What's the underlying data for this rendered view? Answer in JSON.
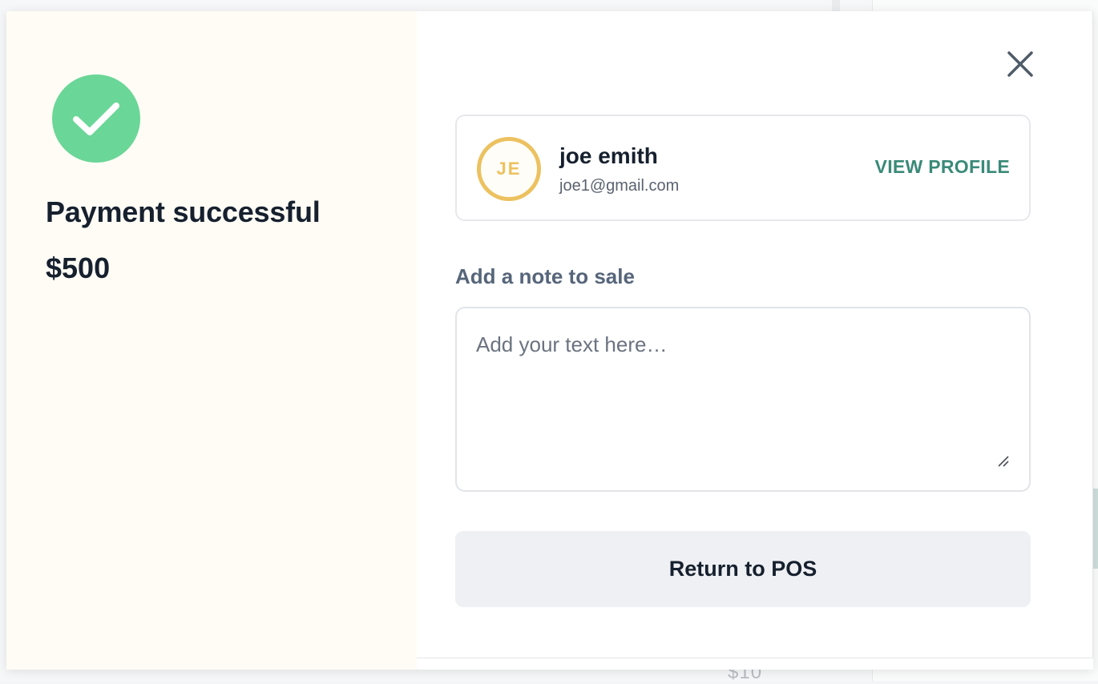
{
  "colors": {
    "success_green": "#6ad697",
    "left_panel_bg": "#fffcf5",
    "avatar_accent": "#ecc15f",
    "link_teal": "#3a8a78",
    "button_bg": "#eff0f3"
  },
  "icons": {
    "success": "check-circle-icon",
    "close": "close-icon",
    "resize": "resize-grip-icon"
  },
  "payment": {
    "status_title": "Payment successful",
    "amount": "$500"
  },
  "customer": {
    "initials": "JE",
    "name": "joe emith",
    "email": "joe1@gmail.com",
    "view_profile_label": "VIEW PROFILE"
  },
  "note": {
    "label": "Add a note to sale",
    "placeholder": "Add your text here…",
    "value": ""
  },
  "actions": {
    "return_label": "Return to POS"
  },
  "background": {
    "partial_price": "$10"
  }
}
